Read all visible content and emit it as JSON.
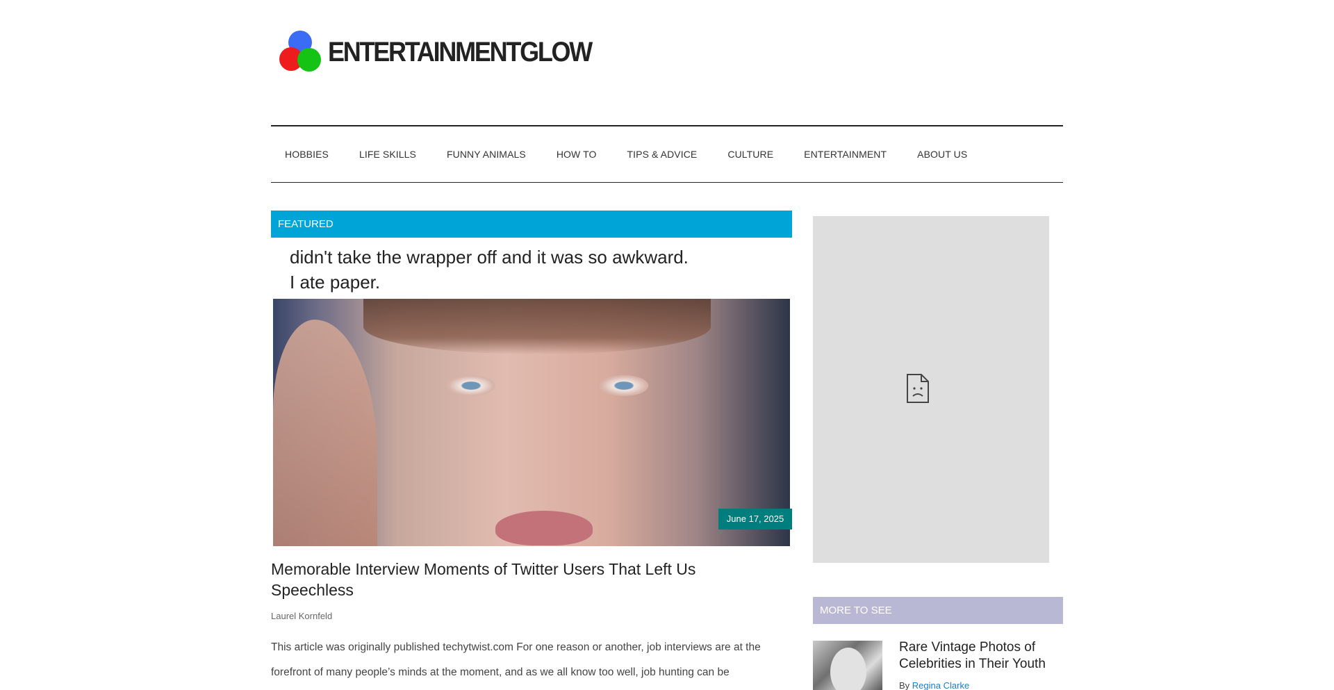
{
  "header": {
    "logo_text": "ENTERTAINMENTGLOW"
  },
  "nav": {
    "items": [
      "HOBBIES",
      "LIFE SKILLS",
      "FUNNY ANIMALS",
      "HOW TO",
      "TIPS & ADVICE",
      "CULTURE",
      "ENTERTAINMENT",
      "ABOUT US"
    ]
  },
  "featured": {
    "section_label": "FEATURED",
    "image_caption_line1": "didn't take the wrapper off and it was so awkward.",
    "image_caption_line2": "I ate paper.",
    "date": "June 17, 2025",
    "title": "Memorable Interview Moments of Twitter Users That Left Us Speechless",
    "author": "Laurel Kornfeld",
    "excerpt": "This article was originally published techytwist.com For one reason or another, job interviews are at the forefront of many people’s minds at the moment, and as we all know too well, job hunting can be"
  },
  "sidebar": {
    "more_label": "MORE TO SEE",
    "item_title": "Rare Vintage Photos of Celebrities in Their Youth",
    "by_prefix": "By",
    "item_author": "Regina Clarke"
  },
  "colors": {
    "featured_bar": "#00a4d6",
    "date_badge": "#007e7e",
    "more_bar": "#b8b8d4",
    "link": "#1a7fc4"
  }
}
